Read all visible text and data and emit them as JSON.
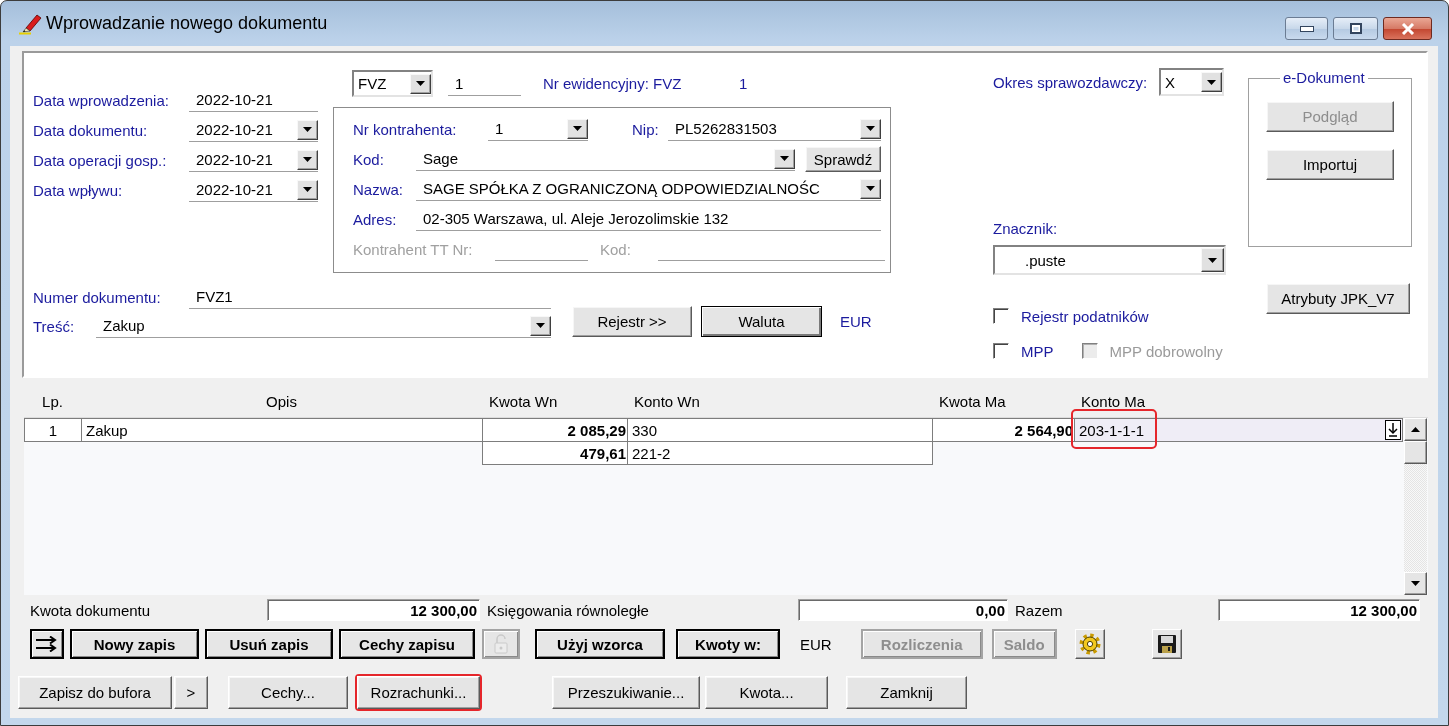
{
  "window": {
    "title": "Wprowadzanie nowego dokumentu"
  },
  "document": {
    "dates": [
      {
        "label": "Data wprowadzenia:",
        "value": "2022-10-21",
        "dropdown": false
      },
      {
        "label": "Data dokumentu:",
        "value": "2022-10-21",
        "dropdown": true
      },
      {
        "label": "Data operacji gosp.:",
        "value": "2022-10-21",
        "dropdown": true
      },
      {
        "label": "Data wpływu:",
        "value": "2022-10-21",
        "dropdown": true
      }
    ],
    "type": "FVZ",
    "sequence": "1",
    "register": {
      "label": "Nr ewidencyjny: FVZ",
      "value": "1"
    },
    "number": {
      "label": "Numer dokumentu:",
      "value": "FVZ1",
      "dropdown": false
    },
    "content": {
      "label": "Treść:",
      "value": "Zakup",
      "dropdown": true
    },
    "buttons": [
      {
        "label": "Rejestr >>",
        "default": false
      },
      {
        "label": "Waluta",
        "default": true
      }
    ],
    "currency": "EUR"
  },
  "contractor": {
    "number": {
      "label": "Nr kontrahenta:",
      "value": "1",
      "dropdown": true
    },
    "nip": {
      "label": "Nip:",
      "value": "PL5262831503",
      "dropdown": true
    },
    "code": {
      "label": "Kod:",
      "value": "Sage",
      "dropdown": true,
      "button": "Sprawdź"
    },
    "name": {
      "label": "Nazwa:",
      "value": "SAGE SPÓŁKA Z OGRANICZONĄ ODPOWIEDZIALNOŚC",
      "dropdown": true
    },
    "address": {
      "label": "Adres:",
      "value": "02-305 Warszawa, ul. Aleje Jerozolimskie 132",
      "dropdown": false
    },
    "tt_number": {
      "label": "Kontrahent TT Nr:",
      "disabled": true
    },
    "tt_code": {
      "label": "Kod:",
      "disabled": true
    }
  },
  "reporting": {
    "period": {
      "label": "Okres sprawozdawczy:",
      "value": "X"
    },
    "tag": {
      "label": "Znacznik:",
      "value": ".puste"
    },
    "checkbox_rows": [
      [
        {
          "label": "Rejestr podatników",
          "checked": false,
          "disabled": false
        }
      ],
      [
        {
          "label": "MPP",
          "checked": false,
          "disabled": false
        },
        {
          "label": "MPP dobrowolny",
          "checked": false,
          "disabled": true
        }
      ]
    ]
  },
  "e_document": {
    "title": "e-Dokument",
    "buttons": [
      {
        "label": "Podgląd",
        "disabled": true
      },
      {
        "label": "Importuj",
        "disabled": false
      }
    ]
  },
  "jpk_button": "Atrybuty JPK_V7",
  "ledger": {
    "columns": [
      "Lp.",
      "Opis",
      "Kwota Wn",
      "Konto Wn",
      "Kwota Ma",
      "Konto Ma"
    ],
    "rows": [
      {
        "lp": "1",
        "description": "Zakup",
        "debit_amount": "2 085,29",
        "debit_account": "330",
        "credit_amount": "2 564,90",
        "credit_account": "203-1-1-1",
        "editing": true,
        "highlighted": true
      },
      {
        "debit_amount": "479,61",
        "debit_account": "221-2",
        "editing": false,
        "highlighted": false
      }
    ]
  },
  "totals": [
    {
      "label": "Kwota dokumentu",
      "value": "12 300,00"
    },
    {
      "label": "Księgowania równoległe",
      "value": "0,00"
    },
    {
      "label": "Razem",
      "value": "12 300,00"
    }
  ],
  "toolbar": [
    {
      "kind": "reorder",
      "disabled": false
    },
    {
      "kind": "button",
      "label": "Nowy zapis",
      "disabled": false
    },
    {
      "kind": "button",
      "label": "Usuń zapis",
      "disabled": false
    },
    {
      "kind": "button",
      "label": "Cechy zapisu",
      "disabled": false
    },
    {
      "kind": "lock",
      "disabled": true
    },
    {
      "kind": "button",
      "label": "Użyj wzorca",
      "disabled": false
    },
    {
      "kind": "button",
      "label": "Kwoty w:",
      "disabled": false
    },
    {
      "kind": "text",
      "label": "EUR"
    },
    {
      "kind": "button",
      "label": "Rozliczenia",
      "disabled": true
    },
    {
      "kind": "button",
      "label": "Saldo",
      "disabled": true
    },
    {
      "kind": "gear",
      "disabled": false
    },
    {
      "kind": "save",
      "disabled": false
    }
  ],
  "actions": [
    {
      "label": "Zapisz do bufora",
      "highlighted": false
    },
    {
      "label": ">",
      "highlighted": false
    },
    {
      "label": "Cechy...",
      "highlighted": false
    },
    {
      "label": "Rozrachunki...",
      "highlighted": true
    },
    {
      "label": "Przeszukiwanie...",
      "highlighted": false
    },
    {
      "label": "Kwota...",
      "highlighted": false
    },
    {
      "label": "Zamknij",
      "highlighted": false
    }
  ]
}
